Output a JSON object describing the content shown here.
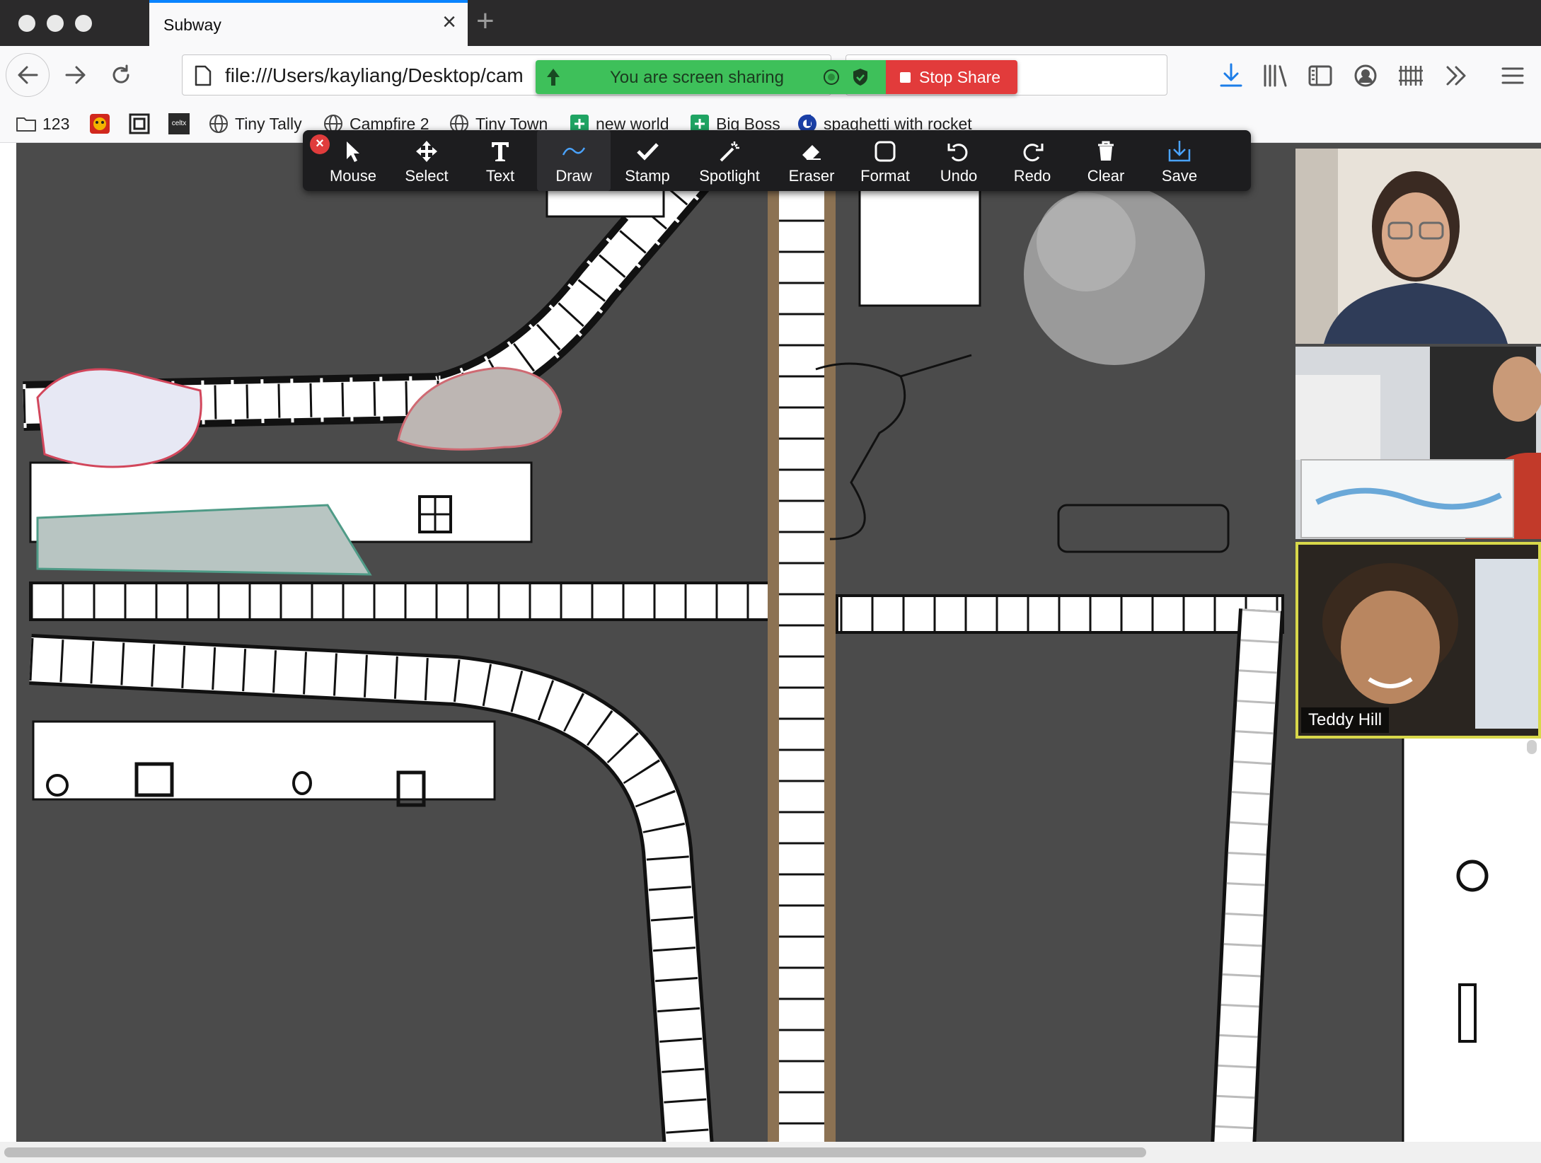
{
  "tab": {
    "title": "Subway",
    "close_glyph": "×",
    "new_tab_glyph": "+"
  },
  "nav": {
    "url": "file:///Users/kayliang/Desktop/cam",
    "icons": [
      "back-arrow-icon",
      "forward-arrow-icon",
      "reload-icon",
      "page-icon",
      "download-icon",
      "library-icon",
      "sidebar-icon",
      "account-icon",
      "extensions-icon",
      "overflow-chevron-icon",
      "menu-icon"
    ]
  },
  "bookmarks": [
    {
      "label": "123",
      "icon": "folder-icon"
    },
    {
      "label": "",
      "icon": "mascot-favicon"
    },
    {
      "label": "",
      "icon": "frame-favicon"
    },
    {
      "label": "",
      "icon": "celtx-favicon",
      "badge": "celtx"
    },
    {
      "label": "Tiny Tally",
      "icon": "globe-icon"
    },
    {
      "label": "Campfire 2",
      "icon": "globe-icon"
    },
    {
      "label": "Tiny Town",
      "icon": "globe-icon"
    },
    {
      "label": "new world",
      "icon": "sheets-icon"
    },
    {
      "label": "Big Boss",
      "icon": "sheets-icon"
    },
    {
      "label": "spaghetti with rocket",
      "icon": "blue-logo-icon"
    }
  ],
  "share": {
    "status_text": "You are screen sharing",
    "stop_label": "Stop Share",
    "colors": {
      "banner": "#3ec05a",
      "stop": "#e23b3b"
    }
  },
  "annotation_toolbar": {
    "close_glyph": "×",
    "tools": [
      {
        "label": "Mouse",
        "icon": "mouse-pointer-icon",
        "active": false
      },
      {
        "label": "Select",
        "icon": "move-arrows-icon",
        "active": false
      },
      {
        "label": "Text",
        "icon": "text-t-icon",
        "active": false
      },
      {
        "label": "Draw",
        "icon": "squiggle-icon",
        "active": true
      },
      {
        "label": "Stamp",
        "icon": "checkmark-icon",
        "active": false
      },
      {
        "label": "Spotlight",
        "icon": "magic-wand-icon",
        "active": false
      },
      {
        "label": "Eraser",
        "icon": "eraser-icon",
        "active": false
      },
      {
        "label": "Format",
        "icon": "rounded-square-icon",
        "active": false
      },
      {
        "label": "Undo",
        "icon": "undo-icon",
        "active": false
      },
      {
        "label": "Redo",
        "icon": "redo-icon",
        "active": false
      },
      {
        "label": "Clear",
        "icon": "trash-icon",
        "active": false
      },
      {
        "label": "Save",
        "icon": "save-download-icon",
        "active": false
      }
    ]
  },
  "participants": [
    {
      "name": "",
      "highlighted": false
    },
    {
      "name": "",
      "highlighted": false
    },
    {
      "name": "Teddy Hill",
      "highlighted": true
    }
  ]
}
